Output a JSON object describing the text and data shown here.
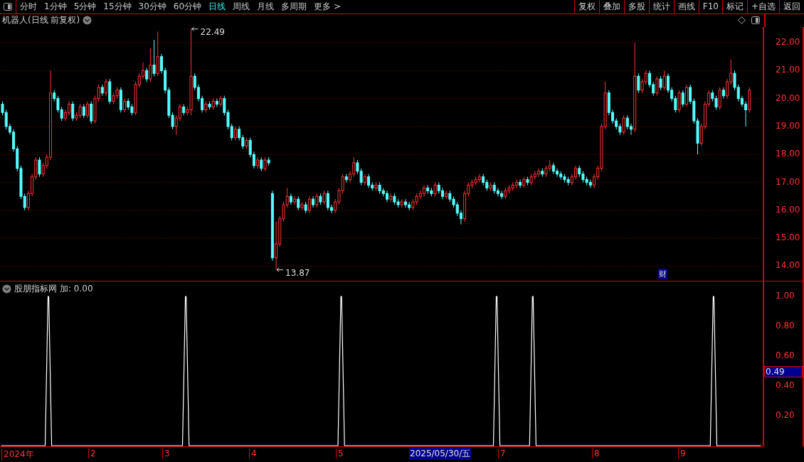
{
  "toolbar": {
    "periods": [
      {
        "label": "分时",
        "selected": false
      },
      {
        "label": "1分钟",
        "selected": false
      },
      {
        "label": "5分钟",
        "selected": false
      },
      {
        "label": "15分钟",
        "selected": false
      },
      {
        "label": "30分钟",
        "selected": false
      },
      {
        "label": "60分钟",
        "selected": false
      },
      {
        "label": "日线",
        "selected": true
      },
      {
        "label": "周线",
        "selected": false
      },
      {
        "label": "月线",
        "selected": false
      },
      {
        "label": "多周期",
        "selected": false
      },
      {
        "label": "更多 >",
        "selected": false
      }
    ],
    "actions": [
      "复权",
      "叠加",
      "多股",
      "统计",
      "画线",
      "F10",
      "标记",
      "+自选",
      "返回"
    ]
  },
  "main_chart": {
    "title": "机器人(日线 前复权)",
    "event_marker": "财",
    "chart_data": {
      "type": "candlestick",
      "ylim": [
        13.48,
        22.56
      ],
      "yticks": [
        {
          "value": 14,
          "label": "14.00"
        },
        {
          "value": 15,
          "label": "15.00"
        },
        {
          "value": 16,
          "label": "16.00"
        },
        {
          "value": 17,
          "label": "17.00"
        },
        {
          "value": 18,
          "label": "18.00"
        },
        {
          "value": 19,
          "label": "19.00"
        },
        {
          "value": 20,
          "label": "20.00"
        },
        {
          "value": 21,
          "label": "21.00"
        },
        {
          "value": 22,
          "label": "22.00"
        }
      ],
      "grid": true,
      "ohlc": [
        [
          19.8,
          19.9,
          19.4,
          19.5
        ],
        [
          19.5,
          19.6,
          18.9,
          19.0
        ],
        [
          19.0,
          19.1,
          18.7,
          18.8
        ],
        [
          18.8,
          18.9,
          18.1,
          18.2
        ],
        [
          18.2,
          18.3,
          17.4,
          17.5
        ],
        [
          17.5,
          17.6,
          16.4,
          16.5
        ],
        [
          16.5,
          16.6,
          16.0,
          16.1
        ],
        [
          16.1,
          16.7,
          16.0,
          16.6
        ],
        [
          16.6,
          17.3,
          16.5,
          17.2
        ],
        [
          17.2,
          17.9,
          17.1,
          17.8
        ],
        [
          17.8,
          17.9,
          17.2,
          17.3
        ],
        [
          17.3,
          17.7,
          17.2,
          17.6
        ],
        [
          17.6,
          18.0,
          17.5,
          17.9
        ],
        [
          17.9,
          21.0,
          17.8,
          20.2
        ],
        [
          20.2,
          20.3,
          19.9,
          20.0
        ],
        [
          20.0,
          20.1,
          19.5,
          19.6
        ],
        [
          19.6,
          19.7,
          19.2,
          19.3
        ],
        [
          19.3,
          19.6,
          19.2,
          19.5
        ],
        [
          19.5,
          19.9,
          19.4,
          19.8
        ],
        [
          19.8,
          19.9,
          19.2,
          19.3
        ],
        [
          19.3,
          19.5,
          19.2,
          19.4
        ],
        [
          19.4,
          19.8,
          19.3,
          19.7
        ],
        [
          19.7,
          19.8,
          19.3,
          19.4
        ],
        [
          19.4,
          19.9,
          19.3,
          19.8
        ],
        [
          19.8,
          19.9,
          19.1,
          19.2
        ],
        [
          19.2,
          20.1,
          19.1,
          20.0
        ],
        [
          20.0,
          20.5,
          19.9,
          20.4
        ],
        [
          20.4,
          20.5,
          20.1,
          20.2
        ],
        [
          20.2,
          20.7,
          20.1,
          20.6
        ],
        [
          20.6,
          20.7,
          19.8,
          19.9
        ],
        [
          19.9,
          20.2,
          19.8,
          20.1
        ],
        [
          20.1,
          20.4,
          20.0,
          20.3
        ],
        [
          20.3,
          20.4,
          19.5,
          19.6
        ],
        [
          19.6,
          20.0,
          19.5,
          19.9
        ],
        [
          19.9,
          20.0,
          19.6,
          19.7
        ],
        [
          19.7,
          19.8,
          19.4,
          19.5
        ],
        [
          19.5,
          20.6,
          19.4,
          20.5
        ],
        [
          20.5,
          20.9,
          20.4,
          20.8
        ],
        [
          20.8,
          21.3,
          20.7,
          21.0
        ],
        [
          21.0,
          21.1,
          20.6,
          20.7
        ],
        [
          20.7,
          21.8,
          20.6,
          21.2
        ],
        [
          21.2,
          22.1,
          20.8,
          20.9
        ],
        [
          20.9,
          22.4,
          20.8,
          21.5
        ],
        [
          21.5,
          21.6,
          20.9,
          21.0
        ],
        [
          21.0,
          21.1,
          20.2,
          20.3
        ],
        [
          20.3,
          20.4,
          19.3,
          19.4
        ],
        [
          19.4,
          19.5,
          18.9,
          19.0
        ],
        [
          19.0,
          19.4,
          18.7,
          19.3
        ],
        [
          19.3,
          19.8,
          19.2,
          19.7
        ],
        [
          19.7,
          19.8,
          19.4,
          19.5
        ],
        [
          19.5,
          19.7,
          19.4,
          19.6
        ],
        [
          19.6,
          22.49,
          19.4,
          20.8
        ],
        [
          20.8,
          20.9,
          20.3,
          20.4
        ],
        [
          20.4,
          20.5,
          19.9,
          20.0
        ],
        [
          20.0,
          20.1,
          19.5,
          19.6
        ],
        [
          19.6,
          19.9,
          19.5,
          19.8
        ],
        [
          19.8,
          19.9,
          19.6,
          19.7
        ],
        [
          19.7,
          20.0,
          19.6,
          19.9
        ],
        [
          19.9,
          20.0,
          19.7,
          19.8
        ],
        [
          19.8,
          20.1,
          19.7,
          20.0
        ],
        [
          20.0,
          20.1,
          19.4,
          19.5
        ],
        [
          19.5,
          19.6,
          18.9,
          19.0
        ],
        [
          19.0,
          19.1,
          18.5,
          18.6
        ],
        [
          18.6,
          19.0,
          18.5,
          18.9
        ],
        [
          18.9,
          19.0,
          18.5,
          18.6
        ],
        [
          18.6,
          18.7,
          18.2,
          18.3
        ],
        [
          18.3,
          18.6,
          18.2,
          18.5
        ],
        [
          18.5,
          18.6,
          17.9,
          18.0
        ],
        [
          18.0,
          18.1,
          17.5,
          17.6
        ],
        [
          17.6,
          17.9,
          17.5,
          17.8
        ],
        [
          17.8,
          17.9,
          17.4,
          17.5
        ],
        [
          17.5,
          17.9,
          17.4,
          17.8
        ],
        [
          17.8,
          17.9,
          17.6,
          17.7
        ],
        [
          16.6,
          16.7,
          14.2,
          14.3
        ],
        [
          14.3,
          15.6,
          13.87,
          14.8
        ],
        [
          14.8,
          15.8,
          14.7,
          15.7
        ],
        [
          15.7,
          16.3,
          15.6,
          16.2
        ],
        [
          16.2,
          16.8,
          16.1,
          16.5
        ],
        [
          16.5,
          16.6,
          16.2,
          16.3
        ],
        [
          16.3,
          16.5,
          16.2,
          16.4
        ],
        [
          16.4,
          16.5,
          16.0,
          16.1
        ],
        [
          16.1,
          16.3,
          16.0,
          16.2
        ],
        [
          16.2,
          16.3,
          15.9,
          16.0
        ],
        [
          16.0,
          16.5,
          15.9,
          16.4
        ],
        [
          16.4,
          16.5,
          16.1,
          16.2
        ],
        [
          16.2,
          16.6,
          16.1,
          16.5
        ],
        [
          16.5,
          16.6,
          16.2,
          16.3
        ],
        [
          16.3,
          16.7,
          16.2,
          16.6
        ],
        [
          16.6,
          16.7,
          16.0,
          16.1
        ],
        [
          16.1,
          16.2,
          15.9,
          16.0
        ],
        [
          16.0,
          16.4,
          15.9,
          16.3
        ],
        [
          16.3,
          16.8,
          16.2,
          16.7
        ],
        [
          16.7,
          17.3,
          16.6,
          17.2
        ],
        [
          17.2,
          17.3,
          17.0,
          17.1
        ],
        [
          17.1,
          17.4,
          17.0,
          17.3
        ],
        [
          17.3,
          17.9,
          17.2,
          17.7
        ],
        [
          17.7,
          17.8,
          17.3,
          17.4
        ],
        [
          17.4,
          17.5,
          16.9,
          17.0
        ],
        [
          17.0,
          17.3,
          16.9,
          17.2
        ],
        [
          17.2,
          17.3,
          16.8,
          16.9
        ],
        [
          16.9,
          17.0,
          16.7,
          16.8
        ],
        [
          16.8,
          17.0,
          16.7,
          16.9
        ],
        [
          16.9,
          17.0,
          16.6,
          16.7
        ],
        [
          16.7,
          16.8,
          16.5,
          16.6
        ],
        [
          16.6,
          16.7,
          16.3,
          16.4
        ],
        [
          16.4,
          16.6,
          16.3,
          16.5
        ],
        [
          16.5,
          16.6,
          16.2,
          16.3
        ],
        [
          16.3,
          16.4,
          16.1,
          16.2
        ],
        [
          16.2,
          16.4,
          16.1,
          16.3
        ],
        [
          16.3,
          16.4,
          16.1,
          16.2
        ],
        [
          16.2,
          16.3,
          16.0,
          16.1
        ],
        [
          16.1,
          16.4,
          16.0,
          16.3
        ],
        [
          16.3,
          16.6,
          16.2,
          16.5
        ],
        [
          16.5,
          16.7,
          16.4,
          16.6
        ],
        [
          16.6,
          16.9,
          16.5,
          16.8
        ],
        [
          16.8,
          16.9,
          16.6,
          16.7
        ],
        [
          16.7,
          16.8,
          16.5,
          16.6
        ],
        [
          16.6,
          17.0,
          16.5,
          16.9
        ],
        [
          16.9,
          17.0,
          16.6,
          16.7
        ],
        [
          16.7,
          16.8,
          16.4,
          16.5
        ],
        [
          16.5,
          16.7,
          16.4,
          16.6
        ],
        [
          16.6,
          16.7,
          16.3,
          16.4
        ],
        [
          16.4,
          16.5,
          16.1,
          16.2
        ],
        [
          16.2,
          16.3,
          15.8,
          15.9
        ],
        [
          15.9,
          16.0,
          15.5,
          15.7
        ],
        [
          15.7,
          16.7,
          15.6,
          16.6
        ],
        [
          16.6,
          17.0,
          16.5,
          16.9
        ],
        [
          16.9,
          17.1,
          16.8,
          17.0
        ],
        [
          17.0,
          17.2,
          16.9,
          17.1
        ],
        [
          17.1,
          17.3,
          17.0,
          17.2
        ],
        [
          17.2,
          17.3,
          16.9,
          17.0
        ],
        [
          17.0,
          17.1,
          16.7,
          16.8
        ],
        [
          16.8,
          17.0,
          16.7,
          16.9
        ],
        [
          16.9,
          17.0,
          16.6,
          16.7
        ],
        [
          16.7,
          16.8,
          16.5,
          16.6
        ],
        [
          16.6,
          16.7,
          16.4,
          16.5
        ],
        [
          16.5,
          16.8,
          16.4,
          16.7
        ],
        [
          16.7,
          16.9,
          16.6,
          16.8
        ],
        [
          16.8,
          17.0,
          16.7,
          16.9
        ],
        [
          16.9,
          17.1,
          16.8,
          17.0
        ],
        [
          17.0,
          17.1,
          16.8,
          16.9
        ],
        [
          16.9,
          17.2,
          16.8,
          17.1
        ],
        [
          17.1,
          17.2,
          16.9,
          17.0
        ],
        [
          17.0,
          17.3,
          16.9,
          17.2
        ],
        [
          17.2,
          17.4,
          17.1,
          17.3
        ],
        [
          17.3,
          17.5,
          17.2,
          17.4
        ],
        [
          17.4,
          17.5,
          17.2,
          17.3
        ],
        [
          17.3,
          17.6,
          17.2,
          17.5
        ],
        [
          17.5,
          17.8,
          17.4,
          17.6
        ],
        [
          17.6,
          17.7,
          17.3,
          17.4
        ],
        [
          17.4,
          17.5,
          17.2,
          17.3
        ],
        [
          17.3,
          17.4,
          17.1,
          17.2
        ],
        [
          17.2,
          17.3,
          17.0,
          17.1
        ],
        [
          17.1,
          17.2,
          16.9,
          17.0
        ],
        [
          17.0,
          17.3,
          16.9,
          17.2
        ],
        [
          17.2,
          17.6,
          17.1,
          17.5
        ],
        [
          17.5,
          17.6,
          17.2,
          17.3
        ],
        [
          17.3,
          17.4,
          17.0,
          17.1
        ],
        [
          17.1,
          17.2,
          16.9,
          17.0
        ],
        [
          17.0,
          17.1,
          16.8,
          16.9
        ],
        [
          16.9,
          17.3,
          16.8,
          17.2
        ],
        [
          17.2,
          17.6,
          17.1,
          17.5
        ],
        [
          17.5,
          19.1,
          17.4,
          19.0
        ],
        [
          19.0,
          20.6,
          18.9,
          20.2
        ],
        [
          20.2,
          20.3,
          19.4,
          19.5
        ],
        [
          19.5,
          19.6,
          19.1,
          19.2
        ],
        [
          19.2,
          19.3,
          18.9,
          19.0
        ],
        [
          19.0,
          19.1,
          18.7,
          18.8
        ],
        [
          18.8,
          19.4,
          18.7,
          19.3
        ],
        [
          19.3,
          19.4,
          18.9,
          19.0
        ],
        [
          19.0,
          19.1,
          18.7,
          18.9
        ],
        [
          18.9,
          22.0,
          18.8,
          20.8
        ],
        [
          20.8,
          20.9,
          20.2,
          20.3
        ],
        [
          20.3,
          20.7,
          20.2,
          20.6
        ],
        [
          20.6,
          21.0,
          20.5,
          20.9
        ],
        [
          20.9,
          21.0,
          20.4,
          20.5
        ],
        [
          20.5,
          20.6,
          20.1,
          20.2
        ],
        [
          20.2,
          20.8,
          20.1,
          20.7
        ],
        [
          20.7,
          20.8,
          20.3,
          20.4
        ],
        [
          20.4,
          21.0,
          20.3,
          20.8
        ],
        [
          20.8,
          20.9,
          20.2,
          20.3
        ],
        [
          20.3,
          20.4,
          19.9,
          20.0
        ],
        [
          20.0,
          20.1,
          19.5,
          19.6
        ],
        [
          19.6,
          20.3,
          19.5,
          20.2
        ],
        [
          20.2,
          20.3,
          19.7,
          19.8
        ],
        [
          19.8,
          20.5,
          19.7,
          20.4
        ],
        [
          20.4,
          20.5,
          19.8,
          19.9
        ],
        [
          19.9,
          20.0,
          19.1,
          19.2
        ],
        [
          19.2,
          19.3,
          18.0,
          18.4
        ],
        [
          18.4,
          19.1,
          18.3,
          19.0
        ],
        [
          19.0,
          19.9,
          18.9,
          19.8
        ],
        [
          19.8,
          20.3,
          19.7,
          20.2
        ],
        [
          20.2,
          20.3,
          19.9,
          20.0
        ],
        [
          20.0,
          20.1,
          19.6,
          19.7
        ],
        [
          19.7,
          20.4,
          19.6,
          20.3
        ],
        [
          20.3,
          20.4,
          20.0,
          20.1
        ],
        [
          20.1,
          20.7,
          20.0,
          20.6
        ],
        [
          20.6,
          21.4,
          20.5,
          20.9
        ],
        [
          20.9,
          21.0,
          20.3,
          20.4
        ],
        [
          20.4,
          20.5,
          19.9,
          20.0
        ],
        [
          20.0,
          20.1,
          19.7,
          19.8
        ],
        [
          19.8,
          19.9,
          19.0,
          19.6
        ],
        [
          19.6,
          20.4,
          19.5,
          20.3
        ]
      ],
      "annotations": [
        "22.49",
        "13.87"
      ]
    }
  },
  "indicator": {
    "title": "股朋指标网",
    "reading": "加: 0.00",
    "cursor_value": "0.49",
    "chart_data": {
      "type": "line",
      "ylim": [
        -0.005,
        1.1
      ],
      "yticks": [
        {
          "value": 0.2,
          "label": "0.20"
        },
        {
          "value": 0.4,
          "label": "0.40"
        },
        {
          "value": 0.6,
          "label": "0.60"
        },
        {
          "value": 0.8,
          "label": "0.80"
        },
        {
          "value": 1.0,
          "label": "1.00"
        }
      ],
      "series": [
        {
          "color": "#ffffff",
          "values": [
            0,
            0,
            0,
            0,
            0,
            0,
            0,
            0,
            0,
            0,
            0,
            0,
            0,
            1,
            0,
            0,
            0,
            0,
            0,
            0,
            0,
            0,
            0,
            0,
            0,
            0,
            0,
            0,
            0,
            0,
            0,
            0,
            0,
            0,
            0,
            0,
            0,
            0,
            0,
            0,
            0,
            0,
            0,
            0,
            0,
            0,
            0,
            0,
            0,
            0,
            0,
            1,
            0,
            0,
            0,
            0,
            0,
            0,
            0,
            0,
            0,
            0,
            0,
            0,
            0,
            0,
            0,
            0,
            0,
            0,
            0,
            0,
            0,
            0,
            0,
            0,
            0,
            0,
            0,
            0,
            0,
            0,
            0,
            0,
            0,
            0,
            0,
            0,
            0,
            0,
            0,
            0,
            0,
            0,
            1,
            0,
            0,
            0,
            0,
            0,
            0,
            0,
            0,
            0,
            0,
            0,
            0,
            0,
            0,
            0,
            0,
            0,
            0,
            0,
            0,
            0,
            0,
            0,
            0,
            0,
            0,
            0,
            0,
            0,
            0,
            0,
            0,
            0,
            0,
            0,
            0,
            0,
            0,
            0,
            0,
            0,
            0,
            1,
            0,
            0,
            0,
            0,
            0,
            0,
            0,
            0,
            0,
            1,
            0,
            0,
            0,
            0,
            0,
            0,
            0,
            0,
            0,
            0,
            0,
            0,
            0,
            0,
            0,
            0,
            0,
            0,
            0,
            0,
            0,
            0,
            0,
            0,
            0,
            0,
            0,
            0,
            0,
            0,
            0,
            0,
            0,
            0,
            0,
            0,
            0,
            0,
            0,
            0,
            0,
            0,
            0,
            0,
            0,
            0,
            0,
            0,
            0,
            1,
            0,
            0,
            0,
            0,
            0,
            0,
            0,
            0,
            0,
            0,
            0,
            0,
            0
          ]
        }
      ]
    }
  },
  "x_axis": {
    "labels": [
      "2024年",
      "2",
      "3",
      "4",
      "5",
      "7",
      "8",
      "9"
    ],
    "cursor_date": "2025/05/30/五"
  }
}
